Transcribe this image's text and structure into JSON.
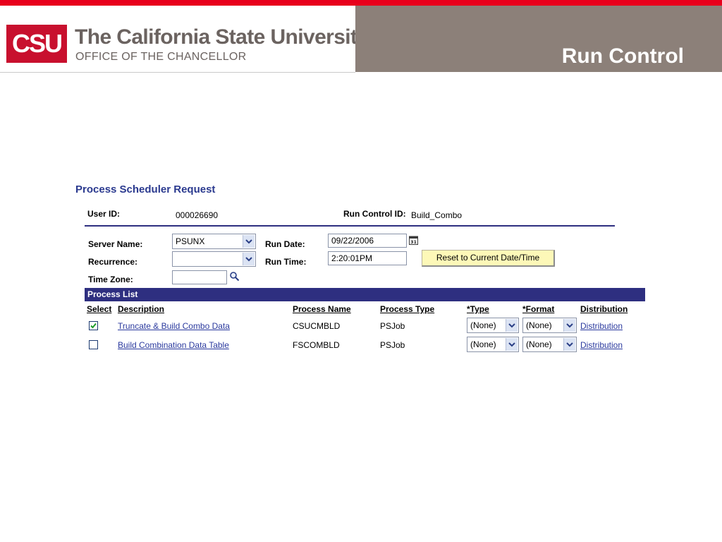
{
  "header": {
    "logo": "CSU",
    "university": "The California State University",
    "office": "OFFICE OF THE CHANCELLOR",
    "slide_title": "Run Control"
  },
  "form": {
    "title": "Process Scheduler Request",
    "user_id_label": "User ID:",
    "user_id_value": "000026690",
    "run_control_label": "Run Control ID:",
    "run_control_value": "Build_Combo",
    "server_name_label": "Server Name:",
    "server_name_value": "PSUNX",
    "recurrence_label": "Recurrence:",
    "recurrence_value": "",
    "time_zone_label": "Time Zone:",
    "time_zone_value": "",
    "run_date_label": "Run Date:",
    "run_date_value": "09/22/2006",
    "run_time_label": "Run Time:",
    "run_time_value": "2:20:01PM",
    "reset_button": "Reset to Current Date/Time"
  },
  "process_list": {
    "title": "Process List",
    "columns": {
      "select": "Select",
      "description": "Description",
      "process_name": "Process Name",
      "process_type": "Process Type",
      "type": "*Type",
      "format": "*Format",
      "distribution": "Distribution"
    },
    "rows": [
      {
        "selected": true,
        "description": "Truncate & Build Combo Data",
        "process_name": "CSUCMBLD",
        "process_type": "PSJob",
        "type": "(None)",
        "format": "(None)",
        "distribution": "Distribution"
      },
      {
        "selected": false,
        "description": "Build Combination Data Table",
        "process_name": "FSCOMBLD",
        "process_type": "PSJob",
        "type": "(None)",
        "format": "(None)",
        "distribution": "Distribution"
      }
    ]
  },
  "icons": {
    "calendar": "calendar-icon",
    "lookup": "search-icon",
    "dropdown": "chevron-down-icon"
  },
  "colors": {
    "brand_red": "#c8102e",
    "header_gray": "#8c8079",
    "ps_navy": "#2e2f80",
    "button_yellow": "#fdf8b8"
  }
}
